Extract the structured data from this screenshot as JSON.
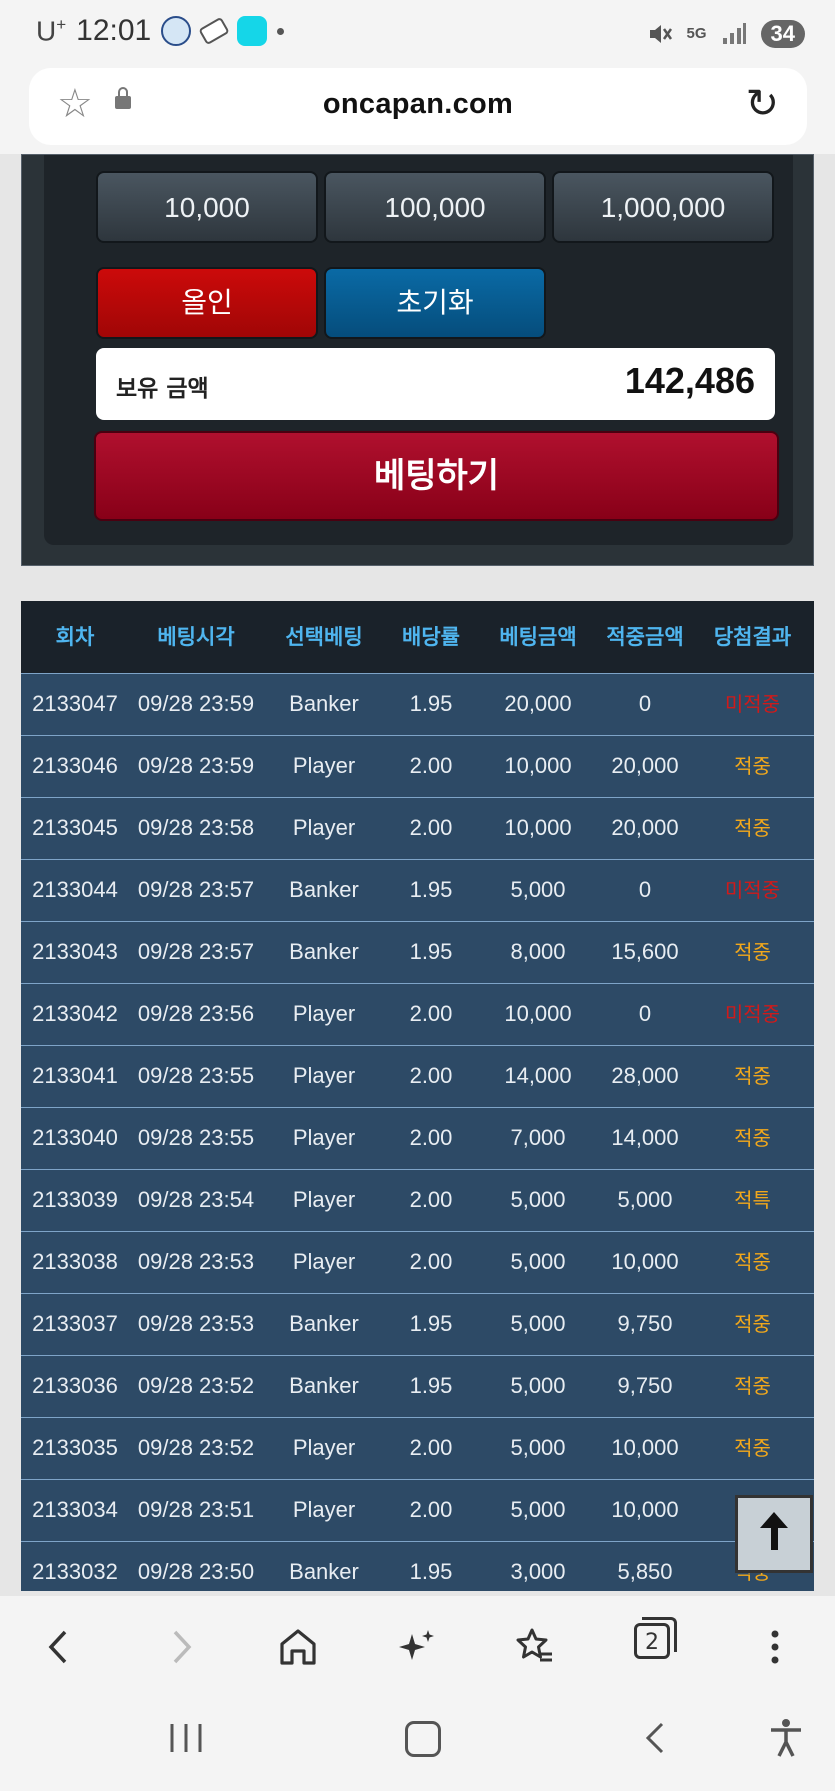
{
  "status": {
    "carrier": "U",
    "carrier_sup": "+",
    "time": "12:01",
    "network": "5G",
    "battery": "34"
  },
  "browser": {
    "url": "oncapan.com",
    "tabs_count": "2"
  },
  "betting_panel": {
    "chips": [
      "10,000",
      "100,000",
      "1,000,000"
    ],
    "allin_label": "올인",
    "reset_label": "초기화",
    "holding_label": "보유 금액",
    "holding_value": "142,486",
    "bet_label": "베팅하기"
  },
  "table": {
    "headers": [
      "회차",
      "베팅시각",
      "선택베팅",
      "배당률",
      "베팅금액",
      "적중금액",
      "당첨결과"
    ],
    "rows": [
      [
        "2133047",
        "09/28 23:59",
        "Banker",
        "1.95",
        "20,000",
        "0",
        "미적중"
      ],
      [
        "2133046",
        "09/28 23:59",
        "Player",
        "2.00",
        "10,000",
        "20,000",
        "적중"
      ],
      [
        "2133045",
        "09/28 23:58",
        "Player",
        "2.00",
        "10,000",
        "20,000",
        "적중"
      ],
      [
        "2133044",
        "09/28 23:57",
        "Banker",
        "1.95",
        "5,000",
        "0",
        "미적중"
      ],
      [
        "2133043",
        "09/28 23:57",
        "Banker",
        "1.95",
        "8,000",
        "15,600",
        "적중"
      ],
      [
        "2133042",
        "09/28 23:56",
        "Player",
        "2.00",
        "10,000",
        "0",
        "미적중"
      ],
      [
        "2133041",
        "09/28 23:55",
        "Player",
        "2.00",
        "14,000",
        "28,000",
        "적중"
      ],
      [
        "2133040",
        "09/28 23:55",
        "Player",
        "2.00",
        "7,000",
        "14,000",
        "적중"
      ],
      [
        "2133039",
        "09/28 23:54",
        "Player",
        "2.00",
        "5,000",
        "5,000",
        "적특"
      ],
      [
        "2133038",
        "09/28 23:53",
        "Player",
        "2.00",
        "5,000",
        "10,000",
        "적중"
      ],
      [
        "2133037",
        "09/28 23:53",
        "Banker",
        "1.95",
        "5,000",
        "9,750",
        "적중"
      ],
      [
        "2133036",
        "09/28 23:52",
        "Banker",
        "1.95",
        "5,000",
        "9,750",
        "적중"
      ],
      [
        "2133035",
        "09/28 23:52",
        "Player",
        "2.00",
        "5,000",
        "10,000",
        "적중"
      ],
      [
        "2133034",
        "09/28 23:51",
        "Player",
        "2.00",
        "5,000",
        "10,000",
        "적중"
      ],
      [
        "2133032",
        "09/28 23:50",
        "Banker",
        "1.95",
        "3,000",
        "5,850",
        "적중"
      ]
    ],
    "result_colors": {
      "hit": "#f2a81b",
      "miss": "#d01a1a"
    }
  },
  "icons": {
    "star": "star-icon",
    "lock": "lock-icon",
    "reload": "reload-icon",
    "back": "back-icon",
    "forward": "forward-icon",
    "home": "home-icon",
    "ai": "sparkle-icon",
    "bookmarks": "bookmarks-icon",
    "tabs": "tabs-icon",
    "menu": "more-icon",
    "to_top": "arrow-up-icon"
  }
}
